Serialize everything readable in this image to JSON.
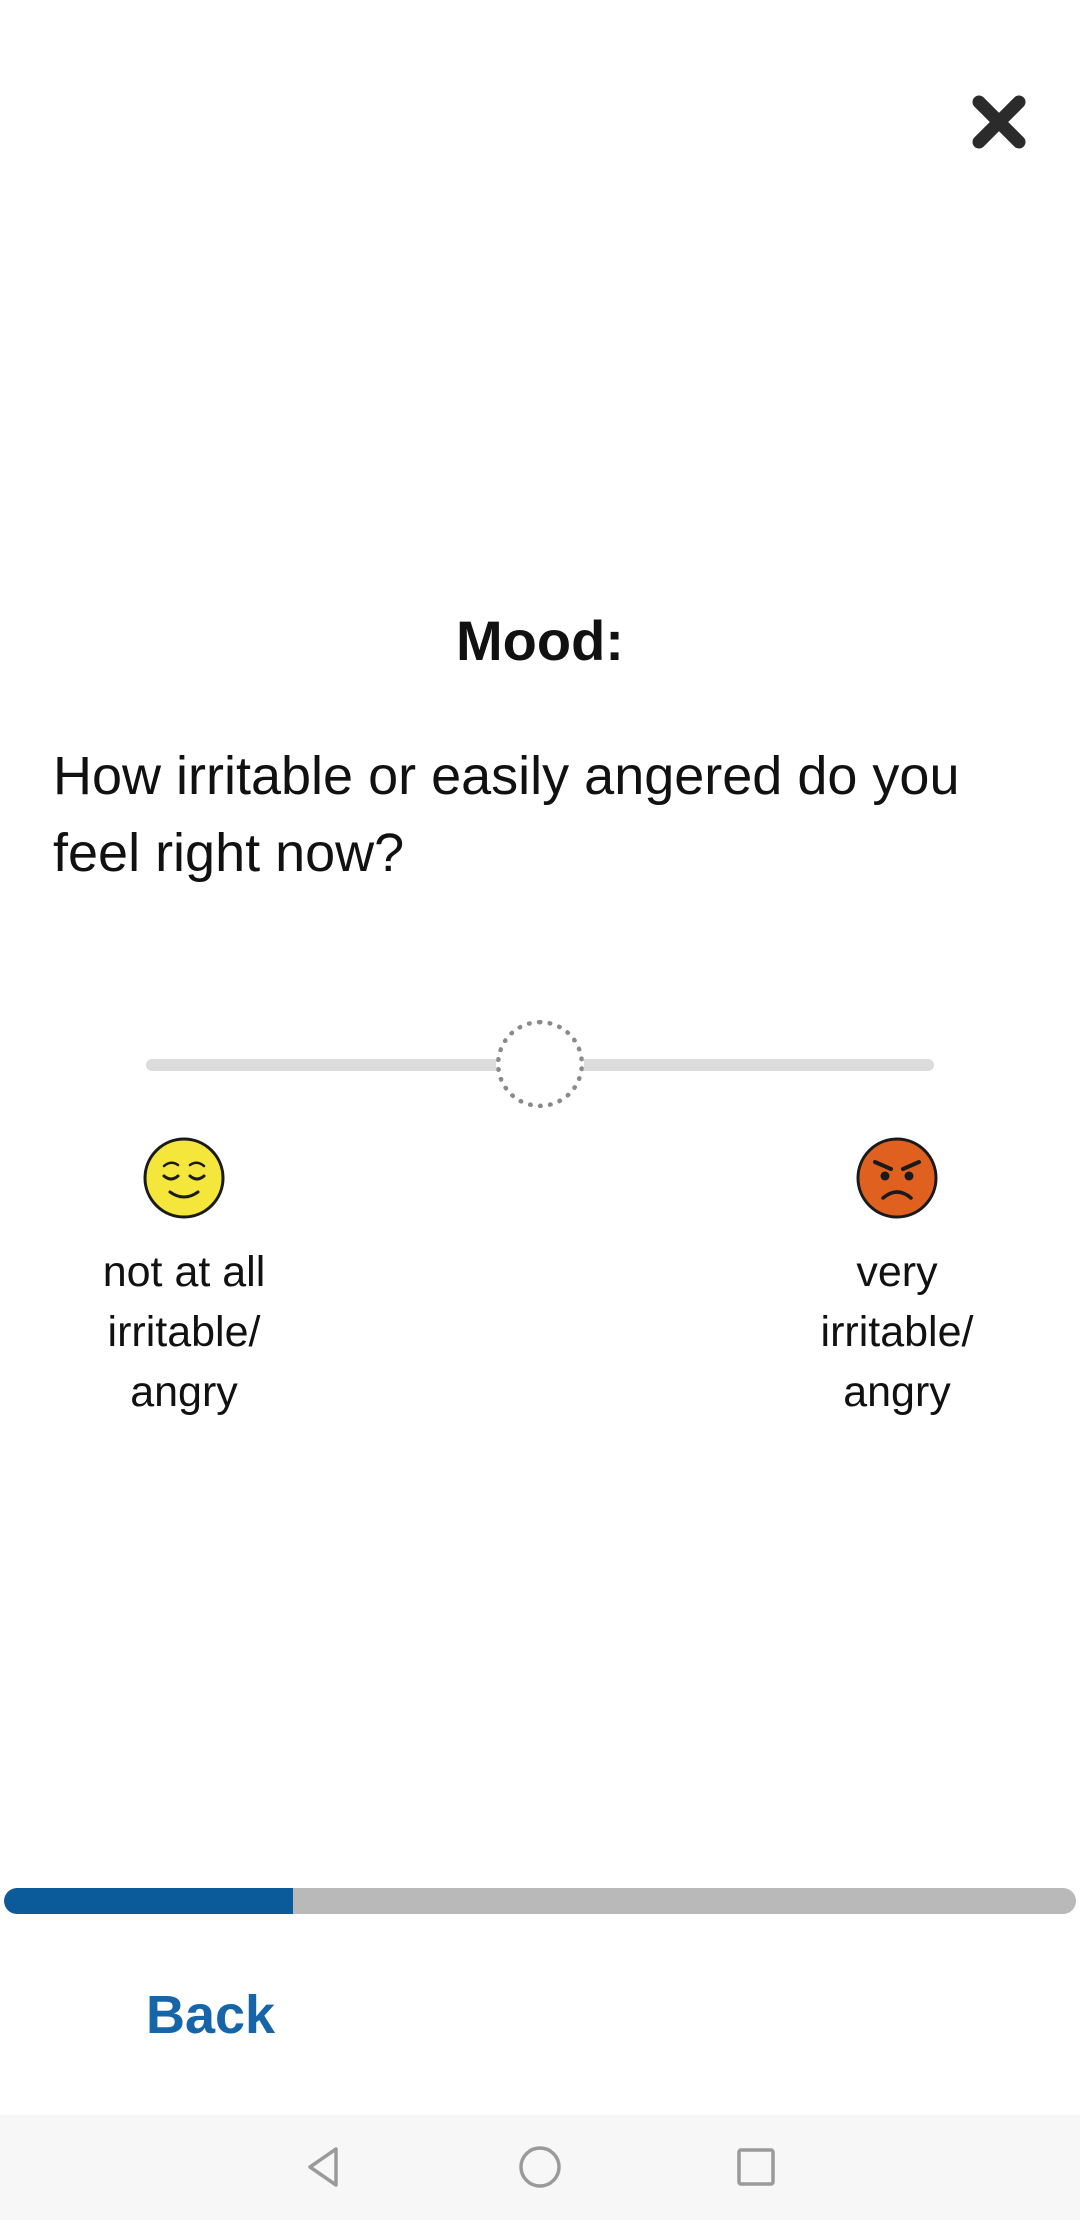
{
  "header": {
    "close_icon": "close-icon"
  },
  "survey": {
    "section_title": "Mood:",
    "question": "How irritable or easily angered do you feel right now?",
    "slider": {
      "value": 0.5,
      "min_label": "not at all irritable/ angry",
      "max_label": "very irritable/ angry",
      "min_icon": "relieved-face-icon",
      "max_icon": "angry-face-icon"
    }
  },
  "progress": {
    "value": 0.27,
    "fill_color": "#0b5a99",
    "track_color": "#b9b9b9"
  },
  "footer": {
    "back_label": "Back"
  },
  "system_nav": {
    "back_icon": "nav-back-icon",
    "home_icon": "nav-home-icon",
    "recents_icon": "nav-recents-icon"
  }
}
